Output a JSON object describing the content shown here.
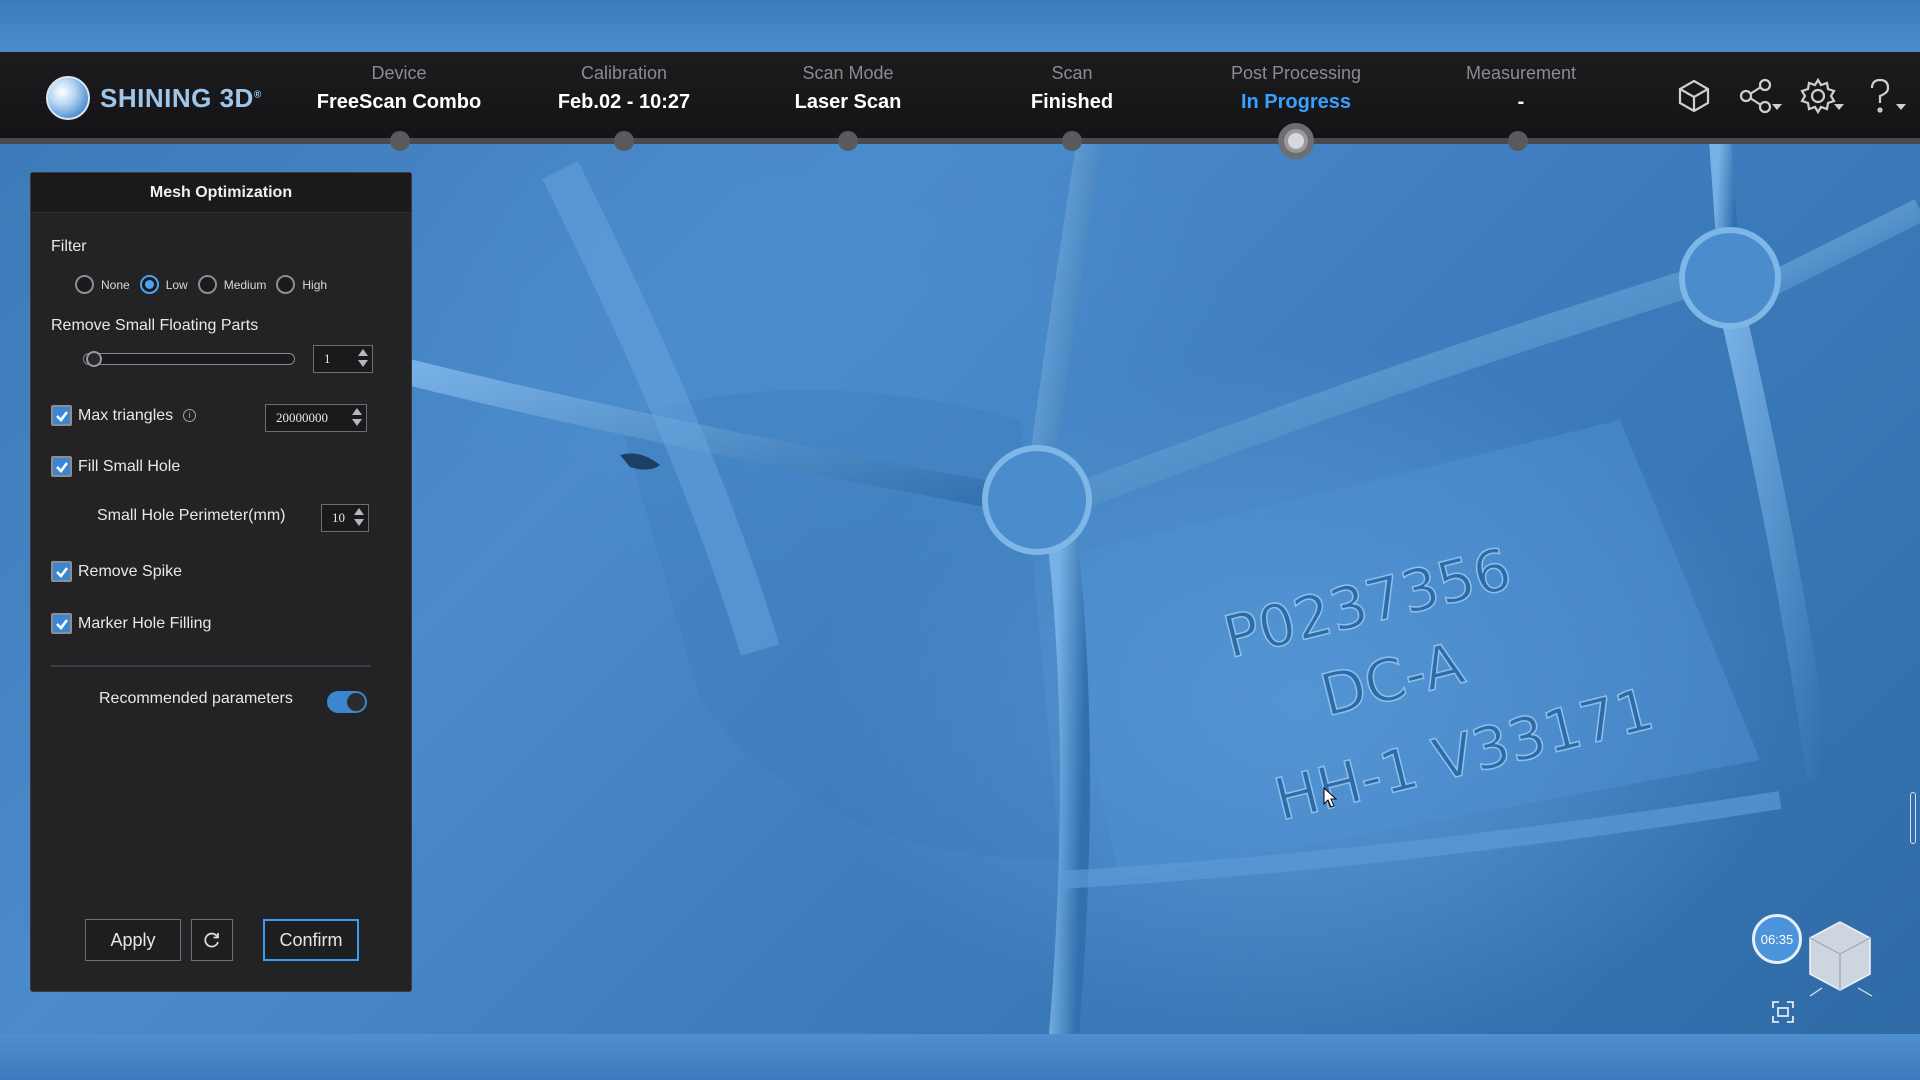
{
  "app": {
    "brand": "SHINING 3D",
    "brand_mark": "®"
  },
  "steps": [
    {
      "label": "Device",
      "value": "FreeScan Combo"
    },
    {
      "label": "Calibration",
      "value": "Feb.02 - 10:27"
    },
    {
      "label": "Scan Mode",
      "value": "Laser Scan"
    },
    {
      "label": "Scan",
      "value": "Finished"
    },
    {
      "label": "Post Processing",
      "value": "In Progress"
    },
    {
      "label": "Measurement",
      "value": "-"
    }
  ],
  "header_icons": [
    "new-model-icon",
    "share-icon",
    "settings-icon",
    "help-icon"
  ],
  "panel": {
    "title": "Mesh Optimization",
    "filter": {
      "label": "Filter",
      "options": [
        "None",
        "Low",
        "Medium",
        "High"
      ],
      "selected": "Low"
    },
    "floating_parts": {
      "label": "Remove Small Floating Parts",
      "value": "1",
      "slider_fraction": 0.0
    },
    "max_triangles": {
      "label": "Max triangles",
      "checked": true,
      "value": "20000000",
      "info_glyph": "i"
    },
    "fill_small_hole": {
      "label": "Fill Small Hole",
      "checked": true
    },
    "hole_perimeter": {
      "label": "Small Hole Perimeter(mm)",
      "value": "10"
    },
    "remove_spike": {
      "label": "Remove Spike",
      "checked": true
    },
    "marker_hole_filling": {
      "label": "Marker Hole Filling",
      "checked": true
    },
    "recommended": {
      "label": "Recommended parameters",
      "on": true
    },
    "buttons": {
      "apply": "Apply",
      "confirm": "Confirm"
    }
  },
  "viewport": {
    "engraving": [
      "P0237356",
      "DC-A",
      "HH-1 V33171"
    ],
    "timer": "06:35",
    "accent_color": "#3b86cf",
    "active_step_color": "#3aa0ff"
  }
}
